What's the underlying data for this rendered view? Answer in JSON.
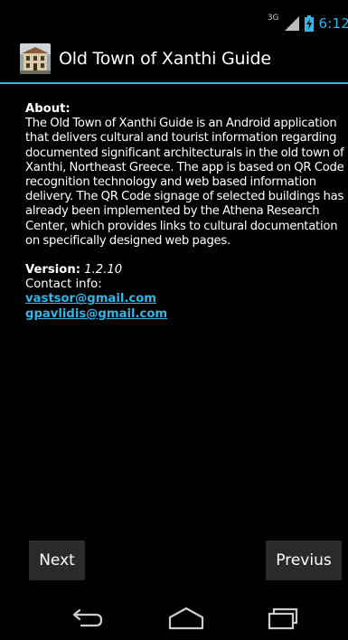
{
  "status_bar": {
    "network_type": "3G",
    "time": "6:12",
    "accent_color": "#33b5e5",
    "icons": [
      "signal-icon",
      "battery-charging-icon"
    ]
  },
  "action_bar": {
    "title": "Old Town of Xanthi Guide",
    "icon": "app-icon"
  },
  "about": {
    "heading": "About:",
    "text": "The Old Town of Xanthi Guide is an Android application that delivers cultural and tourist information regarding documented significant architecturals in the old town of Xanthi, Northeast Greece. The app is based on QR Code recognition technology and web based information delivery. The QR Code signage of selected buildings has already been implemented by the Athena Research Center, which provides links to cultural documentation on specifically designed web pages."
  },
  "version": {
    "label": "Version:",
    "value": " 1.2.10"
  },
  "contact": {
    "label": "Contact info:",
    "emails": [
      "vastsor@gmail.com",
      "gpavlidis@gmail.com"
    ]
  },
  "buttons": {
    "next_label": "Next",
    "prev_label": "Previus"
  },
  "nav_bar": {
    "icons": [
      "back-icon",
      "home-icon",
      "recents-icon"
    ]
  }
}
